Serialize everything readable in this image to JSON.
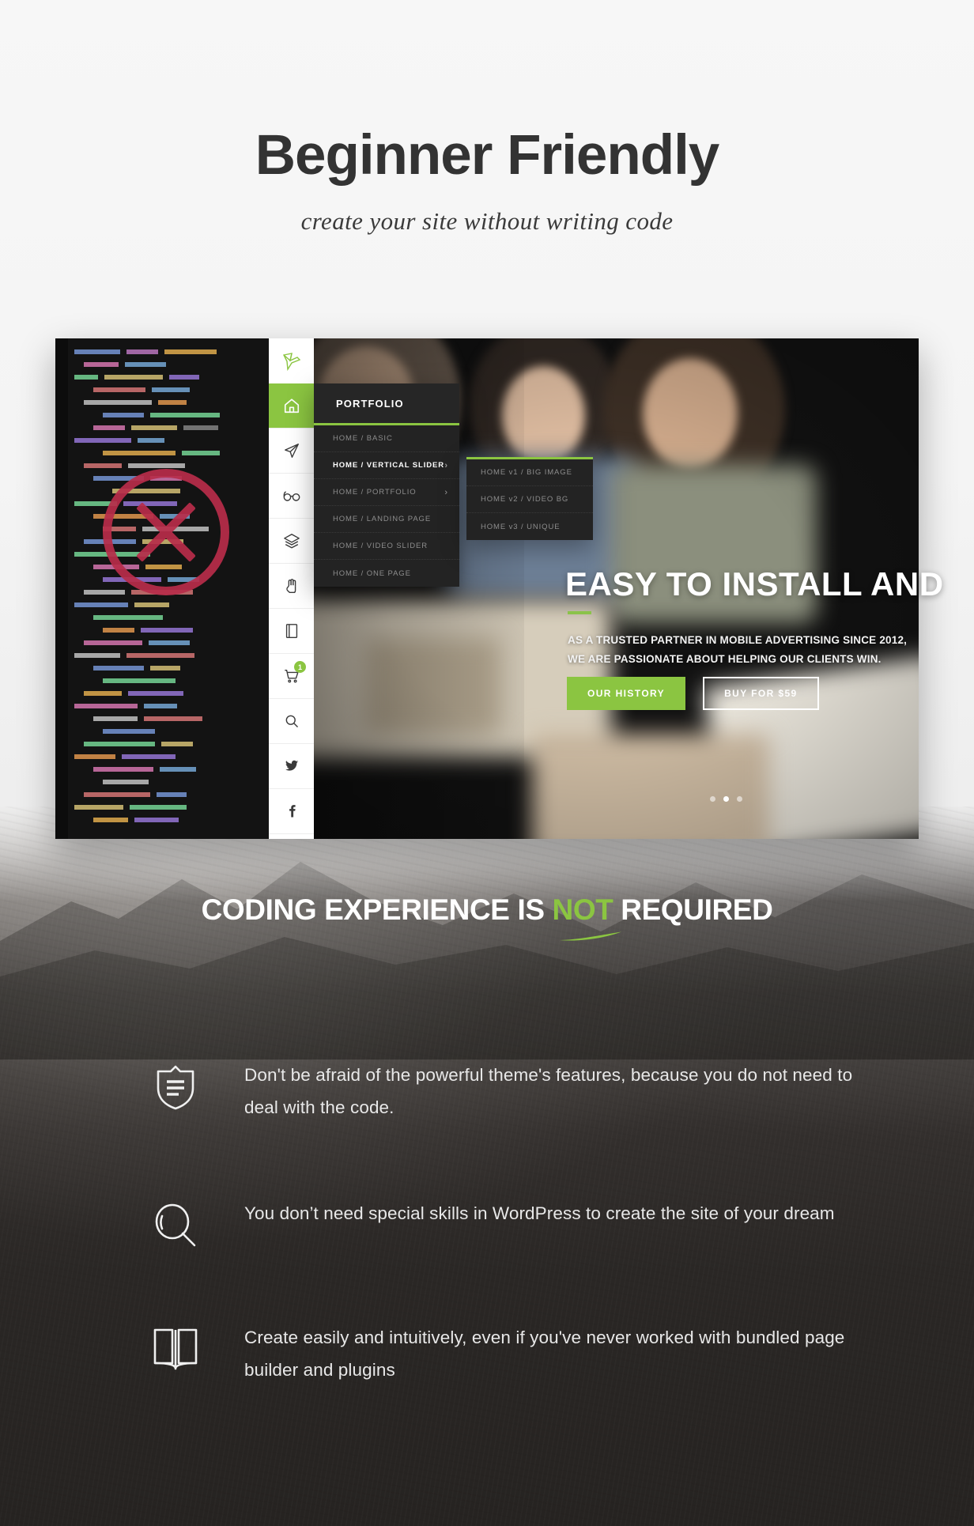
{
  "hero": {
    "headline": "Beginner Friendly",
    "subheadline": "create your site without writing code"
  },
  "demo": {
    "nav_rail": [
      {
        "name": "bird-logo-icon",
        "label": "Logo"
      },
      {
        "name": "home-icon",
        "label": "Home"
      },
      {
        "name": "paper-plane-icon",
        "label": "Contact"
      },
      {
        "name": "glasses-icon",
        "label": "About"
      },
      {
        "name": "layers-icon",
        "label": "Portfolio"
      },
      {
        "name": "hand-icon",
        "label": "Services"
      },
      {
        "name": "book-icon",
        "label": "Blog"
      },
      {
        "name": "cart-icon",
        "label": "Shop",
        "badge": "1"
      },
      {
        "name": "search-icon",
        "label": "Search"
      },
      {
        "name": "twitter-icon",
        "label": "Twitter"
      },
      {
        "name": "facebook-icon",
        "label": "Facebook"
      }
    ],
    "menu": {
      "title": "PORTFOLIO",
      "items": [
        {
          "label": "HOME  /  BASIC",
          "arrow": "",
          "active": false
        },
        {
          "label": "HOME  /  VERTICAL SLIDER",
          "arrow": "›",
          "active": true
        },
        {
          "label": "HOME  /  PORTFOLIO",
          "arrow": "›",
          "active": false
        },
        {
          "label": "HOME  /  LANDING PAGE",
          "arrow": "",
          "active": false
        },
        {
          "label": "HOME  /  VIDEO SLIDER",
          "arrow": "",
          "active": false
        },
        {
          "label": "HOME  /  ONE PAGE",
          "arrow": "",
          "active": false
        }
      ]
    },
    "submenu": {
      "items": [
        {
          "label": "HOME v1  /  BIG IMAGE"
        },
        {
          "label": "HOME v2  /  VIDEO BG"
        },
        {
          "label": "HOME v3  /  UNIQUE"
        }
      ]
    },
    "slide": {
      "title": "EASY TO INSTALL AND",
      "body": "AS A TRUSTED PARTNER IN MOBILE ADVERTISING SINCE 2012, WE ARE PASSIONATE ABOUT HELPING OUR CLIENTS WIN.",
      "primary_button": "OUR HISTORY",
      "secondary_button": "BUY FOR $59",
      "slide_count": 3,
      "active_slide": 2
    },
    "no_code_marker": "cross-circle-icon"
  },
  "section": {
    "heading_part1": "CODING EXPERIENCE IS ",
    "heading_highlight": "NOT",
    "heading_part2": " REQUIRED",
    "features": [
      {
        "icon": "shield-document-icon",
        "text": "Don't be afraid of the powerful theme's features, because you do not need to deal with the code."
      },
      {
        "icon": "magnifier-icon",
        "text": "You don’t need special skills in WordPress to create the site of your dream"
      },
      {
        "icon": "open-book-icon",
        "text": "Create easily and intuitively, even if you've never worked with bundled page builder and plugins"
      }
    ]
  },
  "colors": {
    "accent_green": "#8bc541",
    "dark_panel": "#232323",
    "marker_red": "#b82d4a",
    "heading_dark": "#333333"
  }
}
